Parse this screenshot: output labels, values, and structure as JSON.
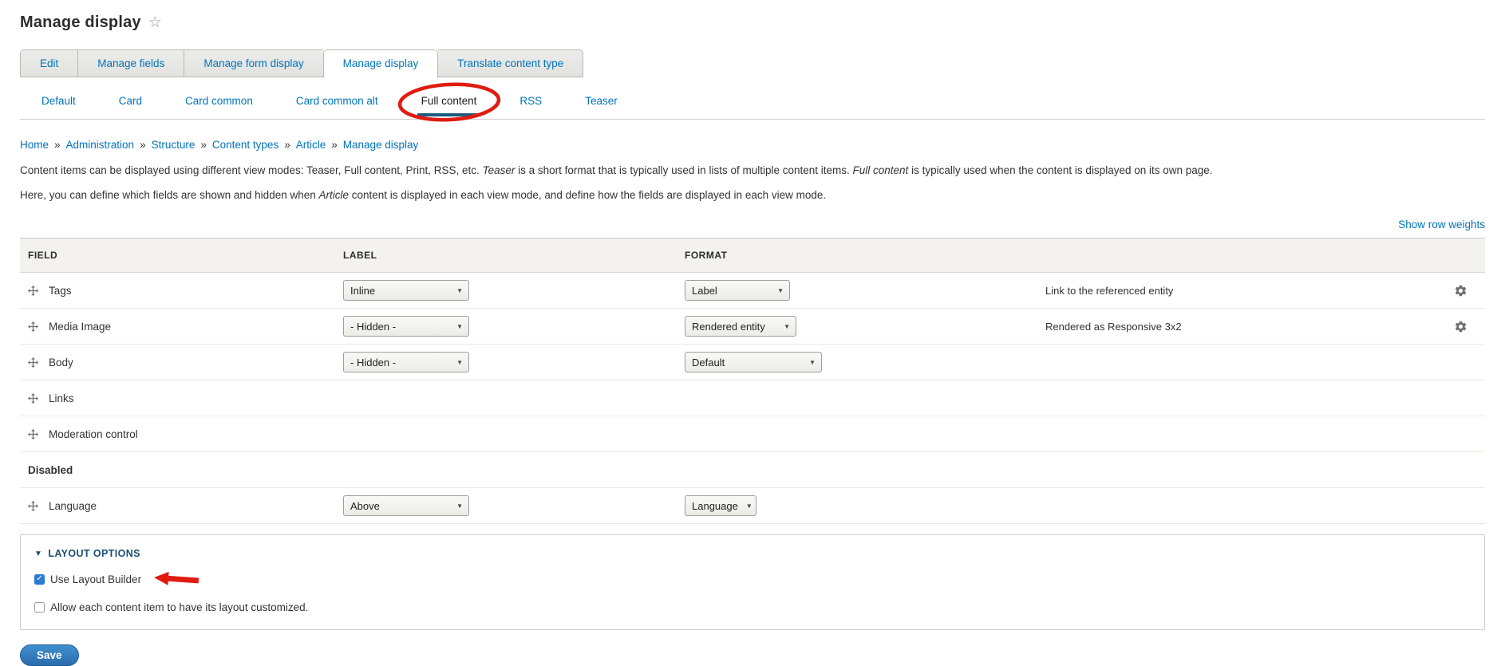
{
  "page": {
    "title": "Manage display"
  },
  "primary_tabs": {
    "items": [
      {
        "label": "Edit",
        "active": false
      },
      {
        "label": "Manage fields",
        "active": false
      },
      {
        "label": "Manage form display",
        "active": false
      },
      {
        "label": "Manage display",
        "active": true
      },
      {
        "label": "Translate content type",
        "active": false
      }
    ]
  },
  "view_mode_tabs": {
    "items": [
      {
        "label": "Default",
        "active": false
      },
      {
        "label": "Card",
        "active": false
      },
      {
        "label": "Card common",
        "active": false
      },
      {
        "label": "Card common alt",
        "active": false
      },
      {
        "label": "Full content",
        "active": true,
        "annotated": true
      },
      {
        "label": "RSS",
        "active": false
      },
      {
        "label": "Teaser",
        "active": false
      }
    ]
  },
  "breadcrumb": {
    "separator": "»",
    "items": [
      "Home",
      "Administration",
      "Structure",
      "Content types",
      "Article",
      "Manage display"
    ]
  },
  "intro": {
    "p1": [
      {
        "t": "Content items can be displayed using different view modes: Teaser, Full content, Print, RSS, etc. "
      },
      {
        "t": "Teaser",
        "i": true
      },
      {
        "t": " is a short format that is typically used in lists of multiple content items. "
      },
      {
        "t": "Full content",
        "i": true
      },
      {
        "t": " is typically used when the content is displayed on its own page."
      }
    ],
    "p2": [
      {
        "t": "Here, you can define which fields are shown and hidden when "
      },
      {
        "t": "Article",
        "i": true
      },
      {
        "t": " content is displayed in each view mode, and define how the fields are displayed in each view mode."
      }
    ]
  },
  "table": {
    "show_row_weights": "Show row weights",
    "headers": [
      "FIELD",
      "LABEL",
      "FORMAT"
    ],
    "disabled_section_label": "Disabled",
    "rows": [
      {
        "name": "Tags",
        "label": "Inline",
        "format": "Label",
        "summary": "Link to the referenced entity",
        "has_settings": true
      },
      {
        "name": "Media Image",
        "label": "- Hidden -",
        "format": "Rendered entity",
        "summary": "Rendered as Responsive 3x2",
        "has_settings": true
      },
      {
        "name": "Body",
        "label": "- Hidden -",
        "format": "Default",
        "summary": "",
        "has_settings": false
      },
      {
        "name": "Links"
      },
      {
        "name": "Moderation control"
      },
      {
        "name": "Language",
        "label": "Above",
        "format": "Language"
      }
    ]
  },
  "layout_options": {
    "collapse_icon": "▼",
    "legend": "LAYOUT OPTIONS",
    "checkboxes": [
      {
        "label": "Use Layout Builder",
        "checked": true,
        "annotated": true
      },
      {
        "label": "Allow each content item to have its layout customized.",
        "checked": false
      }
    ]
  },
  "save_button": "Save",
  "colors": {
    "link_blue": "#0074bd",
    "active_tab_underline": "#1d5a7e",
    "legend_blue": "#1b4e74",
    "checkbox_blue": "#2d7ad4",
    "annotation_red": "#e01b10",
    "table_header_bg": "#f3f2ee",
    "save_button_blue": "#2a6cad"
  }
}
